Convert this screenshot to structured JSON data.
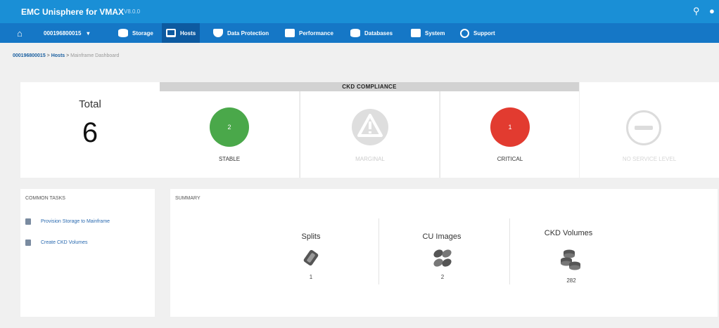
{
  "app": {
    "title": "EMC Unisphere for VMAX",
    "version": "V8.0.0"
  },
  "nav": {
    "array": "000196800015",
    "items": [
      {
        "label": "Storage"
      },
      {
        "label": "Hosts"
      },
      {
        "label": "Data Protection"
      },
      {
        "label": "Performance"
      },
      {
        "label": "Databases"
      },
      {
        "label": "System"
      },
      {
        "label": "Support"
      }
    ]
  },
  "breadcrumb": {
    "array": "000196800015",
    "section": "Hosts",
    "page": "Mainframe Dashboard"
  },
  "total": {
    "label": "Total",
    "value": "6"
  },
  "ckd_compliance": {
    "title": "CKD COMPLIANCE",
    "cards": [
      {
        "count": "2",
        "label": "STABLE",
        "color": "#4aa84a"
      },
      {
        "count": "",
        "label": "MARGINAL",
        "color": "#dcdcdc"
      },
      {
        "count": "1",
        "label": "CRITICAL",
        "color": "#e23b30"
      }
    ],
    "no_service_level": {
      "label": "NO SERVICE LEVEL"
    }
  },
  "common_tasks": {
    "title": "COMMON TASKS",
    "items": [
      {
        "label": "Provision Storage to Mainframe"
      },
      {
        "label": "Create CKD Volumes"
      }
    ]
  },
  "summary": {
    "title": "SUMMARY",
    "items": [
      {
        "label": "Splits",
        "value": "1"
      },
      {
        "label": "CU Images",
        "value": "2"
      },
      {
        "label": "CKD Volumes",
        "value": "282"
      }
    ]
  },
  "colors": {
    "header": "#1a8fd6",
    "nav": "#1577c6",
    "nav_active": "#0d5aa0",
    "link": "#2a6ab0"
  },
  "icons": {
    "home": "home-icon",
    "search": "search-icon",
    "user": "user-icon",
    "split": "split-icon",
    "cu_images": "cu-images-icon",
    "ckd_volumes": "ckd-volumes-icon"
  }
}
